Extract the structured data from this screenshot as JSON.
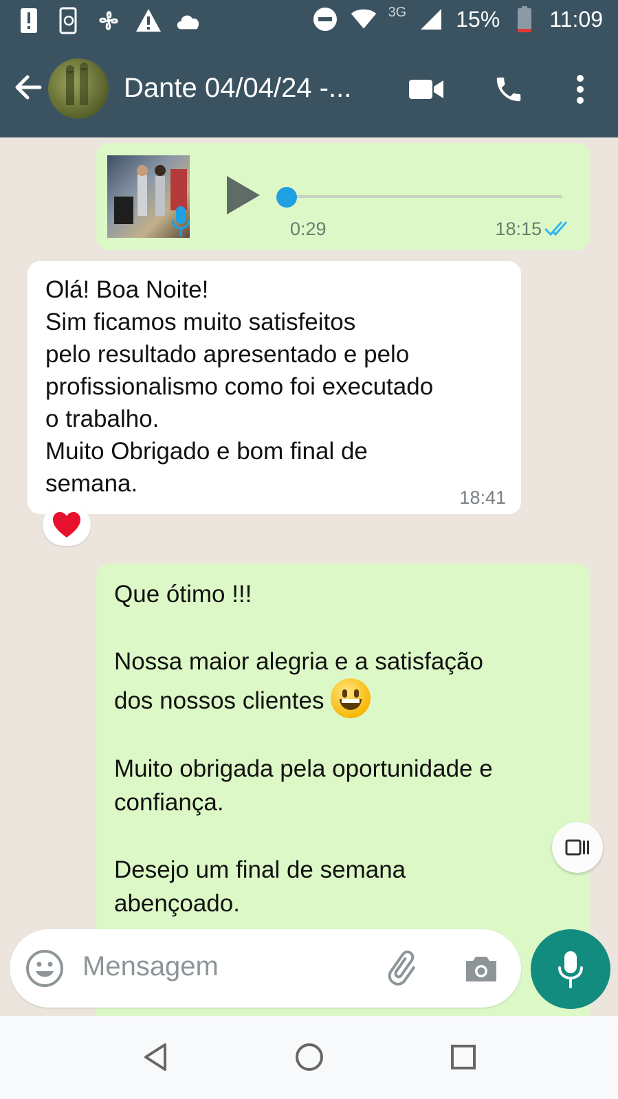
{
  "status_bar": {
    "network": "3G",
    "battery": "15%",
    "time": "11:09"
  },
  "header": {
    "title": "Dante 04/04/24 -..."
  },
  "messages": [
    {
      "type": "voice",
      "direction": "outgoing",
      "duration": "0:29",
      "time": "18:15",
      "status": "read"
    },
    {
      "type": "text",
      "direction": "incoming",
      "text": "Olá! Boa Noite!\nSim ficamos muito satisfeitos\npelo resultado apresentado e pelo\nprofissionalismo como foi executado\no trabalho.\nMuito Obrigado e bom final de\nsemana.",
      "time": "18:41",
      "reaction": "❤️"
    },
    {
      "type": "text",
      "direction": "outgoing",
      "lines": [
        "Que ótimo !!!",
        "",
        "Nossa maior alegria e a satisfação",
        "dos nossos clientes",
        "",
        "Muito obrigada pela oportunidade e",
        "confiança.",
        "",
        "Desejo um final de semana",
        "abençoado."
      ]
    }
  ],
  "composer": {
    "placeholder": "Mensagem"
  },
  "colors": {
    "header": "#3b5361",
    "outgoing_bubble": "#dcf8c6",
    "incoming_bubble": "#ffffff",
    "accent": "#128c7e",
    "read_ticks": "#34b7f1"
  }
}
